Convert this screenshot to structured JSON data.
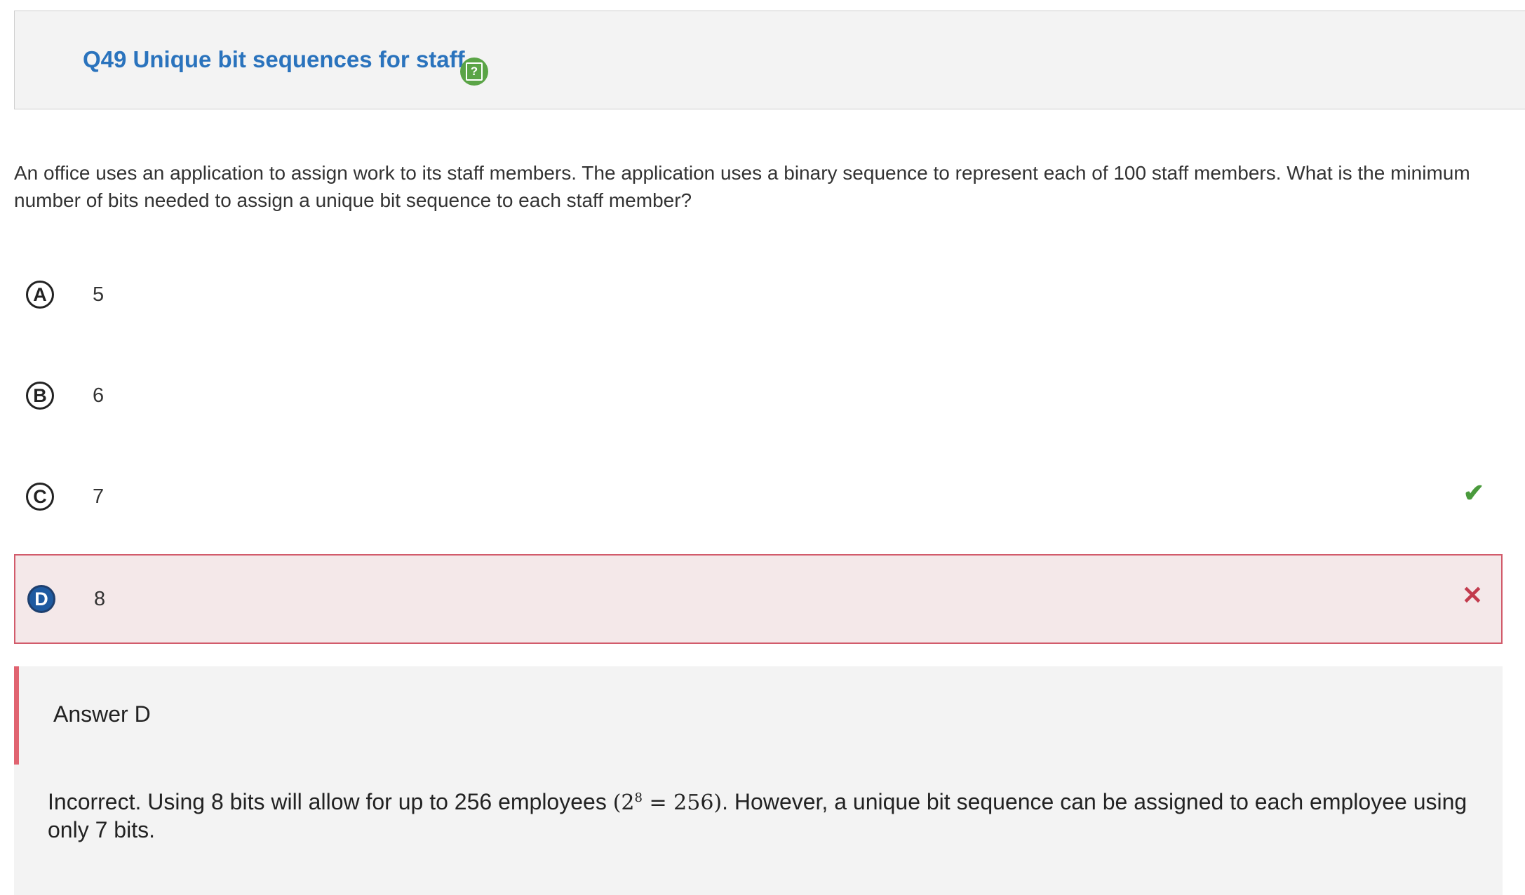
{
  "header": {
    "title": "Q49 Unique bit sequences for staff",
    "help_icon": "help-icon",
    "help_glyph": "?"
  },
  "question": {
    "text": "An office uses an application to assign work to its staff members. The application uses a binary sequence to represent each of 100 staff members. What is the minimum number of bits needed to assign a unique bit sequence to each staff member?"
  },
  "choices": [
    {
      "letter": "A",
      "value": "5",
      "state": "none"
    },
    {
      "letter": "B",
      "value": "6",
      "state": "none"
    },
    {
      "letter": "C",
      "value": "7",
      "state": "correct",
      "mark": "✔"
    },
    {
      "letter": "D",
      "value": "8",
      "state": "selected-incorrect",
      "mark": "✕"
    }
  ],
  "feedback": {
    "answer_label": "Answer D",
    "explanation_before": "Incorrect. Using 8 bits will allow for up to 256 employees ",
    "math_base": "(2",
    "math_exp": "8",
    "math_rest": " = 256)",
    "explanation_after": ". However, a unique bit sequence can be assigned to each employee using only 7 bits."
  },
  "colors": {
    "title": "#2a73bd",
    "correct": "#4a9a3c",
    "incorrect": "#c23b4d",
    "selected_bg": "#f4e8e9",
    "selected_letter": "#1e5aa0",
    "feedback_accent": "#e06370"
  }
}
